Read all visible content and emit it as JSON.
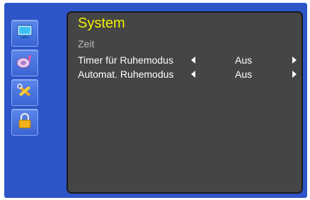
{
  "menu": {
    "title": "System",
    "section": "Zeit",
    "items": [
      {
        "label": "Timer für Ruhemodus",
        "value": "Aus"
      },
      {
        "label": "Automat. Ruhemodus",
        "value": "Aus"
      }
    ]
  },
  "sidebar": {
    "items": [
      {
        "icon": "monitor-icon"
      },
      {
        "icon": "audio-icon"
      },
      {
        "icon": "tools-icon"
      },
      {
        "icon": "lock-icon"
      }
    ]
  },
  "colors": {
    "frame": "#2e55c8",
    "panel": "#454545",
    "title": "#f2f000"
  }
}
